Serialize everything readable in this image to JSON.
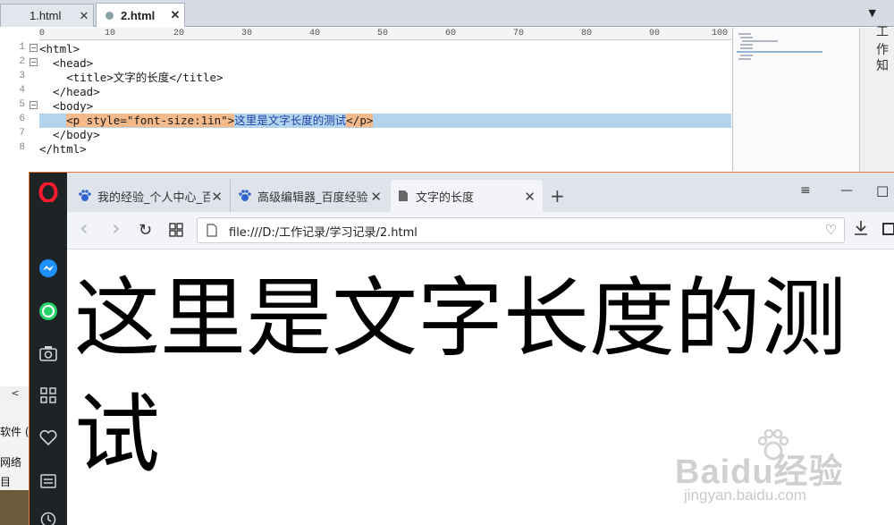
{
  "editor": {
    "tabs": [
      {
        "label": "1.html",
        "close": "✕"
      },
      {
        "label": "2.html",
        "close": "✕"
      }
    ],
    "dropdown": "▼",
    "ruler_ticks": [
      "0",
      "10",
      "20",
      "30",
      "40",
      "50",
      "60",
      "70",
      "80",
      "90",
      "100"
    ],
    "line_numbers": [
      "1",
      "2",
      "3",
      "4",
      "5",
      "6",
      "7",
      "8"
    ],
    "code": {
      "l1": "<html>",
      "l2": "  <head>",
      "l3_open": "    <title>",
      "l3_text": "文字的长度",
      "l3_close": "</title>",
      "l4": "  </head>",
      "l5": "  <body>",
      "l6_indent": "    ",
      "l6_open": "<p style=\"font-size:1in\">",
      "l6_text": "这里是文字长度的测试",
      "l6_close": "</p>",
      "l7": "  </body>",
      "l8": "</html>"
    },
    "right_panel": [
      "工作",
      "知"
    ],
    "side_labels": [
      "软件 (",
      "网络",
      "目"
    ],
    "hscroll_arrow": "<"
  },
  "browser": {
    "tabs": [
      {
        "label": "我的经验_个人中心_百",
        "close": "✕"
      },
      {
        "label": "高级编辑器_百度经验",
        "close": "✕"
      },
      {
        "label": "文字的长度",
        "close": "✕"
      }
    ],
    "new_tab": "+",
    "window_controls": {
      "menu": "≡",
      "minimize": "—",
      "maximize": "☐",
      "close": "✕"
    },
    "nav": {
      "back": "‹",
      "forward": "›",
      "reload": "↻"
    },
    "url": "file:///D:/工作记录/学习记录/2.html",
    "page_text": "这里是文字长度的测试"
  },
  "watermark": {
    "brand": "Baidu经验",
    "url": "jingyan.baidu.com"
  },
  "colors": {
    "highlight_line": "#b2d4ef",
    "tag_selection": "#f6b98a",
    "opera_red": "#ff1b2d",
    "messenger_blue": "#1e90ff",
    "whatsapp_green": "#25d366",
    "sidebar_bg": "#1e2326"
  }
}
